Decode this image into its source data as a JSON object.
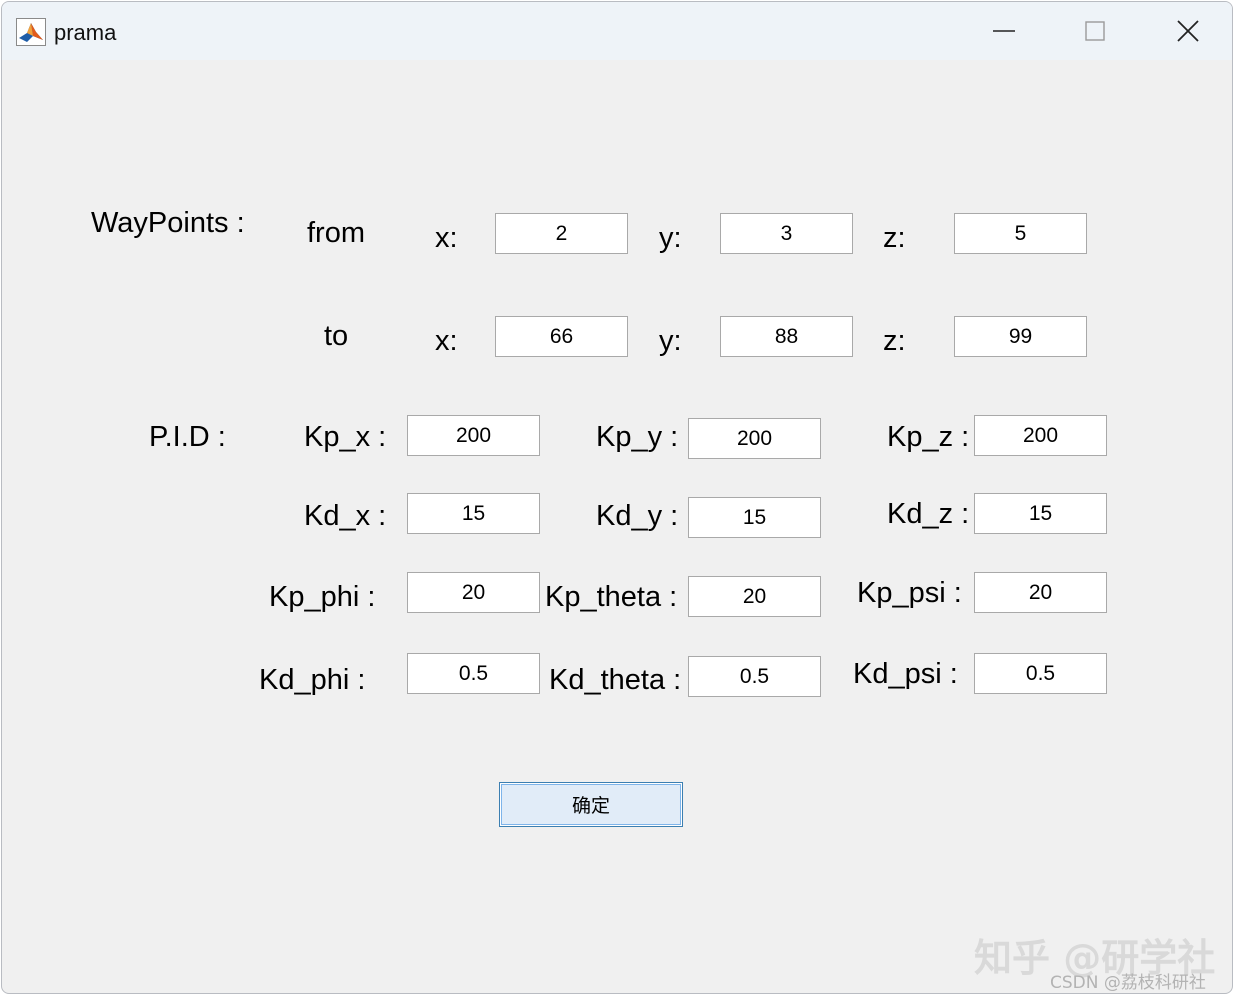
{
  "window": {
    "title": "prama",
    "icon": "matlab-icon",
    "controls": [
      "minimize-icon",
      "maximize-icon",
      "close-icon"
    ]
  },
  "waypoints": {
    "label": "WayPoints :",
    "from_label": "from",
    "to_label": "to",
    "axis_labels": {
      "x": "x:",
      "y": "y:",
      "z": "z:"
    },
    "from": {
      "x": "2",
      "y": "3",
      "z": "5"
    },
    "to": {
      "x": "66",
      "y": "88",
      "z": "99"
    }
  },
  "pid": {
    "label": "P.I.D :",
    "kp_x_label": "Kp_x :",
    "kp_x": "200",
    "kp_y_label": "Kp_y :",
    "kp_y": "200",
    "kp_z_label": "Kp_z :",
    "kp_z": "200",
    "kd_x_label": "Kd_x :",
    "kd_x": "15",
    "kd_y_label": "Kd_y :",
    "kd_y": "15",
    "kd_z_label": "Kd_z :",
    "kd_z": "15",
    "kp_phi_label": "Kp_phi :",
    "kp_phi": "20",
    "kp_theta_label": "Kp_theta :",
    "kp_theta": "20",
    "kp_psi_label": "Kp_psi :",
    "kp_psi": "20",
    "kd_phi_label": "Kd_phi :",
    "kd_phi": "0.5",
    "kd_theta_label": "Kd_theta :",
    "kd_theta": "0.5",
    "kd_psi_label": "Kd_psi :",
    "kd_psi": "0.5"
  },
  "confirm_label": "确定",
  "watermark": {
    "main": "知乎 @研学社",
    "sub": "CSDN @荔枝科研社"
  }
}
